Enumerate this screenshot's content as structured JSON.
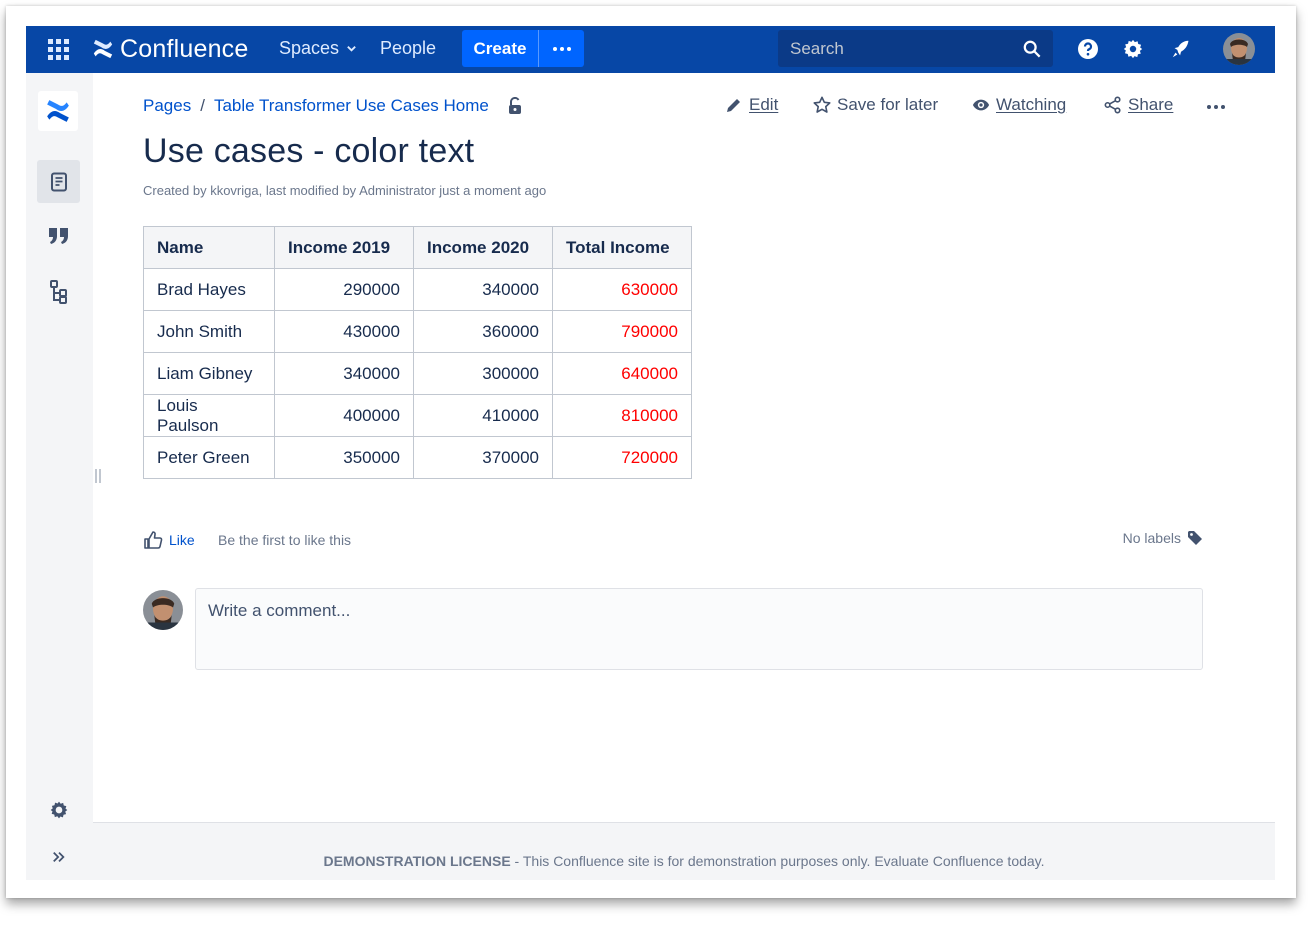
{
  "topnav": {
    "brand": "Confluence",
    "spaces_label": "Spaces",
    "people_label": "People",
    "create_label": "Create",
    "search_placeholder": "Search",
    "bg_color": "#0747a6",
    "create_color": "#0065ff"
  },
  "sidebar": {
    "icons": [
      "confluence-logo-icon",
      "pages-icon",
      "quote-icon",
      "page-tree-icon",
      "gear-icon",
      "expand-icon"
    ]
  },
  "breadcrumb": {
    "items": [
      "Pages",
      "Table Transformer Use Cases Home"
    ],
    "separator": "/"
  },
  "actions": {
    "edit": "Edit",
    "save_for_later": "Save for later",
    "watching": "Watching",
    "share": "Share"
  },
  "page": {
    "title": "Use cases - color text",
    "byline_prefix": "Created by ",
    "creator": "kkovriga",
    "byline_mid": ", last modified by ",
    "modifier": "Administrator",
    "byline_time": " just a moment ago"
  },
  "table": {
    "headers": [
      "Name",
      "Income 2019",
      "Income 2020",
      "Total Income"
    ],
    "rows": [
      [
        "Brad Hayes",
        "290000",
        "340000",
        "630000"
      ],
      [
        "John Smith",
        "430000",
        "360000",
        "790000"
      ],
      [
        "Liam Gibney",
        "340000",
        "300000",
        "640000"
      ],
      [
        "Louis Paulson",
        "400000",
        "410000",
        "810000"
      ],
      [
        "Peter Green",
        "350000",
        "370000",
        "720000"
      ]
    ],
    "highlight_color": "#ff0000"
  },
  "feedback": {
    "like_label": "Like",
    "first_like": "Be the first to like this",
    "no_labels": "No labels"
  },
  "comment": {
    "placeholder": "Write a comment..."
  },
  "footer": {
    "license": "DEMONSTRATION LICENSE",
    "text": " - This Confluence site is for demonstration purposes only. ",
    "link": "Evaluate Confluence today."
  }
}
